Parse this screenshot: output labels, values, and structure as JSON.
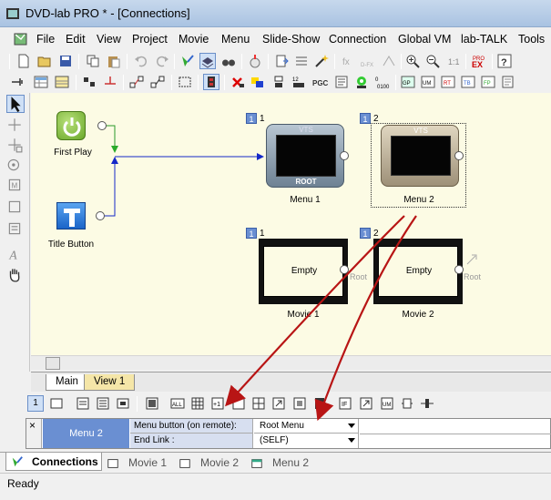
{
  "window": {
    "title": "DVD-lab PRO * - [Connections]"
  },
  "menubar": [
    "File",
    "Edit",
    "View",
    "Project",
    "Movie",
    "Menu",
    "Slide-Show",
    "Connection",
    "Global VM",
    "lab-TALK",
    "Tools"
  ],
  "canvas": {
    "first_play_label": "First Play",
    "title_button_label": "Title Button",
    "menu1": {
      "badge": "1",
      "num": "1",
      "vts": "VTS",
      "root": "ROOT",
      "label": "Menu 1"
    },
    "menu2": {
      "badge": "1",
      "num": "2",
      "vts": "VTS",
      "label": "Menu 2"
    },
    "movie1": {
      "badge": "1",
      "num": "1",
      "content": "Empty",
      "root": "Root",
      "label": "Movie 1"
    },
    "movie2": {
      "badge": "1",
      "num": "2",
      "content": "Empty",
      "root": "Root",
      "label": "Movie 2"
    }
  },
  "tabs": {
    "main": "Main",
    "view1": "View 1"
  },
  "propbar": {
    "first": "1"
  },
  "grid": {
    "close": "×",
    "selected": "Menu 2",
    "rows": [
      {
        "label": "Menu button (on remote):",
        "value": "Root Menu"
      },
      {
        "label": "End Link :",
        "value": "(SELF)"
      }
    ]
  },
  "bottom_tabs": [
    "Connections",
    "Movie 1",
    "Movie 2",
    "Menu 2"
  ],
  "status": "Ready",
  "colors": {
    "canvas_bg": "#fcfbe4",
    "arrow_red": "#b81515",
    "link_blue": "#1428c8",
    "tab_view1": "#f5e6a8"
  }
}
